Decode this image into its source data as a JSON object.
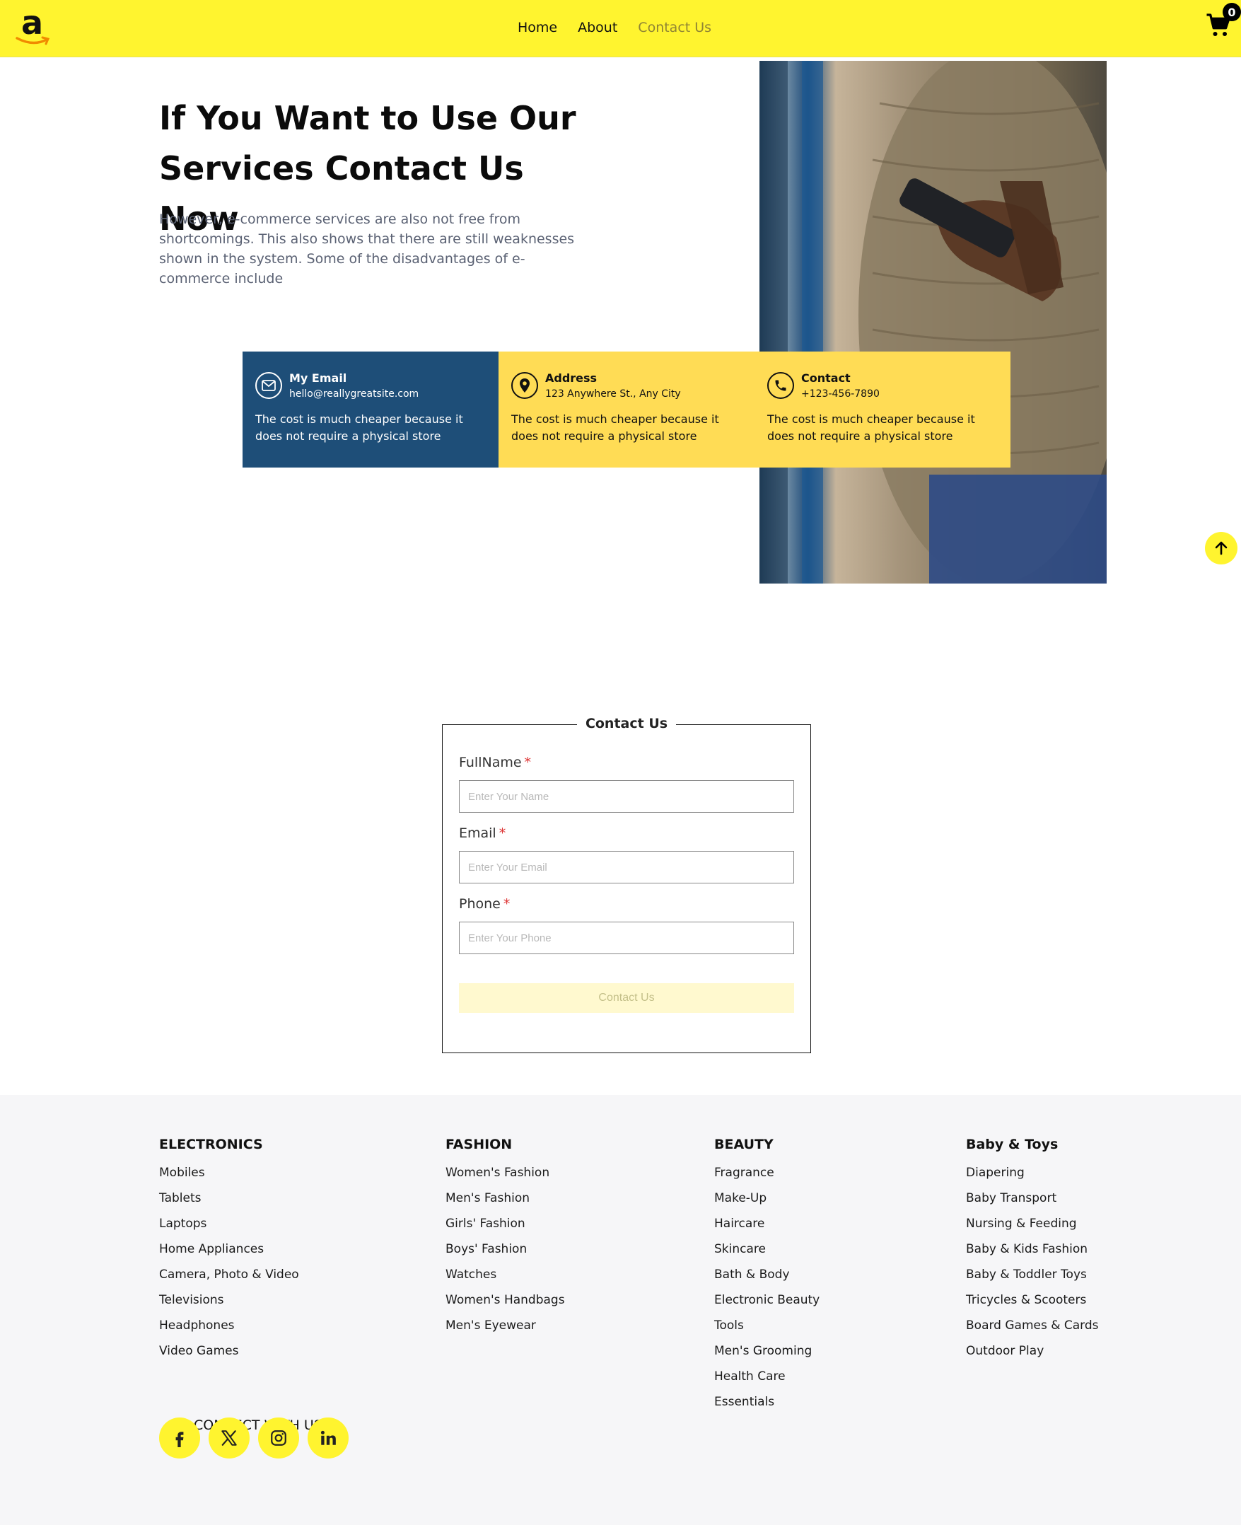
{
  "header": {
    "logo_letter": "a",
    "nav": [
      "Home",
      "About",
      "Contact Us"
    ],
    "active_nav": "Contact Us",
    "cart_count": "0"
  },
  "hero": {
    "title": "If You Want to Use Our Services Contact Us Now",
    "text": "However, e-commerce services are also not free from shortcomings. This also shows that there are still weaknesses shown in the system. Some of the disadvantages of e-commerce include"
  },
  "cards": [
    {
      "icon": "mail-icon",
      "title": "My Email",
      "sub": "hello@reallygreatsite.com",
      "text": "The cost is much cheaper because it does not require a physical store"
    },
    {
      "icon": "location-pin-icon",
      "title": "Address",
      "sub": "123 Anywhere St., Any City",
      "text": "The cost is much cheaper because it does not require a physical store"
    },
    {
      "icon": "phone-icon",
      "title": "Contact",
      "sub": "+123-456-7890",
      "text": "The cost is much cheaper because it does not require a physical store"
    }
  ],
  "form": {
    "legend": "Contact Us",
    "fields": [
      {
        "label": "FullName",
        "placeholder": "Enter Your Name"
      },
      {
        "label": "Email",
        "placeholder": "Enter Your Email"
      },
      {
        "label": "Phone",
        "placeholder": "Enter Your Phone"
      }
    ],
    "required_mark": "*",
    "submit": "Contact Us"
  },
  "footer": {
    "columns": [
      {
        "title": "ELECTRONICS",
        "items": [
          "Mobiles",
          "Tablets",
          "Laptops",
          "Home Appliances",
          "Camera, Photo & Video",
          "Televisions",
          "Headphones",
          "Video Games"
        ]
      },
      {
        "title": "FASHION",
        "items": [
          "Women's Fashion",
          "Men's Fashion",
          "Girls' Fashion",
          "Boys' Fashion",
          "Watches",
          "Women's Handbags",
          "Men's Eyewear"
        ]
      },
      {
        "title": "BEAUTY",
        "items": [
          "Fragrance",
          "Make-Up",
          "Haircare",
          "Skincare",
          "Bath & Body",
          "Electronic Beauty",
          "Tools",
          "Men's Grooming",
          "Health Care",
          "Essentials"
        ]
      },
      {
        "title": "Baby & Toys",
        "items": [
          "Diapering",
          "Baby Transport",
          "Nursing & Feeding",
          "Baby & Kids Fashion",
          "Baby & Toddler Toys",
          "Tricycles & Scooters",
          "Board Games & Cards",
          "Outdoor Play"
        ]
      }
    ],
    "connect_label": "CONNECT WITH US",
    "socials": [
      "facebook-icon",
      "x-icon",
      "instagram-icon",
      "linkedin-icon"
    ]
  },
  "colors": {
    "accent": "#fff42f",
    "card_blue": "#1e4e78",
    "card_yellow": "#ffdc55",
    "footer_bg": "#f6f6f8"
  }
}
